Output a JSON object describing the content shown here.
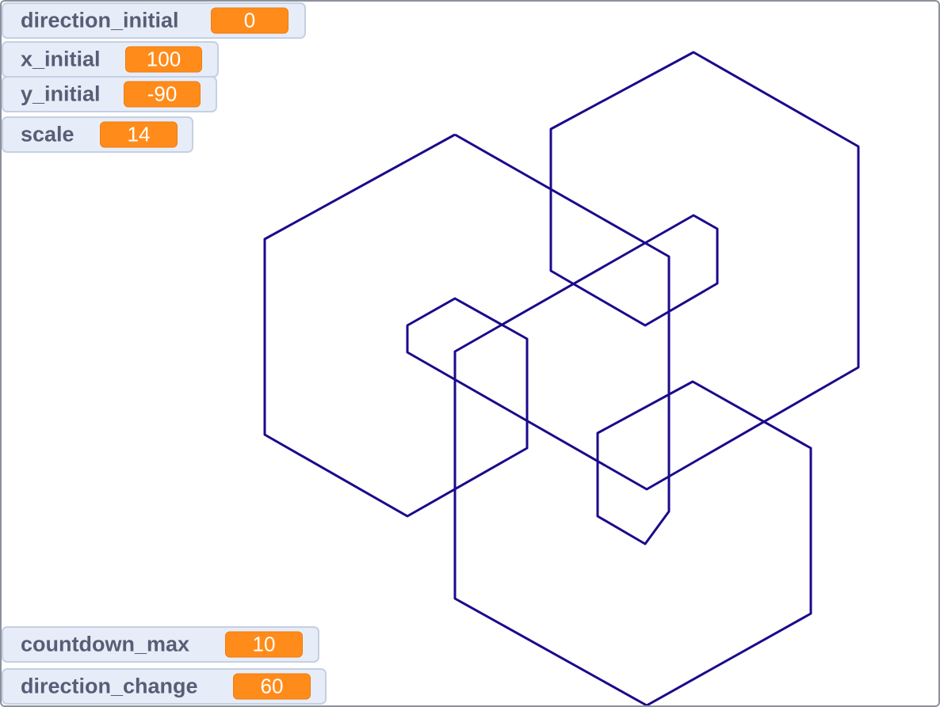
{
  "stage": {
    "pen_color": "#1a0a8c",
    "background": "#ffffff"
  },
  "monitors": {
    "direction_initial": {
      "label": "direction_initial",
      "value": "0"
    },
    "x_initial": {
      "label": "x_initial",
      "value": "100"
    },
    "y_initial": {
      "label": "y_initial",
      "value": "-90"
    },
    "scale": {
      "label": "scale",
      "value": "14"
    },
    "countdown_max": {
      "label": "countdown_max",
      "value": "10"
    },
    "direction_change": {
      "label": "direction_change",
      "value": "60"
    }
  },
  "colors": {
    "monitor_bg": "#e6edf9",
    "monitor_border": "#c5d0e2",
    "label_text": "#575e75",
    "value_bg": "#ff8c1a",
    "value_text": "#ffffff"
  }
}
